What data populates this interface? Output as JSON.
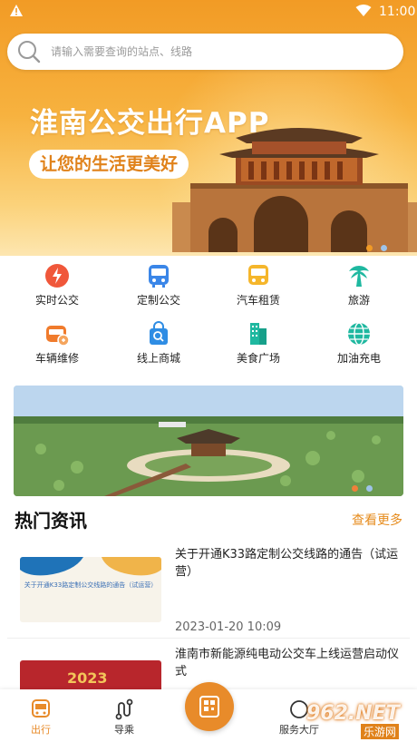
{
  "status_bar": {
    "time": "11:00"
  },
  "search": {
    "placeholder": "请输入需要查询的站点、线路"
  },
  "hero": {
    "title": "淮南公交出行APP",
    "subtitle": "让您的生活更美好"
  },
  "services": [
    {
      "label": "实时公交",
      "icon": "lightning-icon",
      "color": "#f0573a"
    },
    {
      "label": "定制公交",
      "icon": "bus-icon",
      "color": "#3a86e8"
    },
    {
      "label": "汽车租赁",
      "icon": "car-rental-icon",
      "color": "#f5b62b"
    },
    {
      "label": "旅游",
      "icon": "palm-tree-icon",
      "color": "#1fb8a0"
    },
    {
      "label": "车辆维修",
      "icon": "repair-car-icon",
      "color": "#f07b2c"
    },
    {
      "label": "线上商城",
      "icon": "shopping-bag-icon",
      "color": "#2f8de4"
    },
    {
      "label": "美食广场",
      "icon": "building-icon",
      "color": "#1fb8a0"
    },
    {
      "label": "加油充电",
      "icon": "globe-icon",
      "color": "#1fb8a0"
    }
  ],
  "news": {
    "title": "热门资讯",
    "more": "查看更多",
    "items": [
      {
        "headline": "关于开通K33路定制公交线路的通告（试运营）",
        "date": "2023-01-20 10:09",
        "thumb_text": "关于开通K33路定制公交线路的通告（试运营）"
      },
      {
        "headline": "淮南市新能源纯电动公交车上线运营启动仪式",
        "thumb_text": "2023"
      }
    ]
  },
  "bottom_nav": {
    "items": [
      {
        "label": "出行",
        "active": true
      },
      {
        "label": "导乘",
        "active": false
      },
      {
        "label": "服务大厅",
        "active": false
      }
    ]
  },
  "watermark": {
    "text": "962.NET",
    "sub": "乐游网"
  },
  "colors": {
    "accent": "#e88b2a",
    "hero_top": "#f29b25",
    "text_active": "#e88b2a"
  }
}
